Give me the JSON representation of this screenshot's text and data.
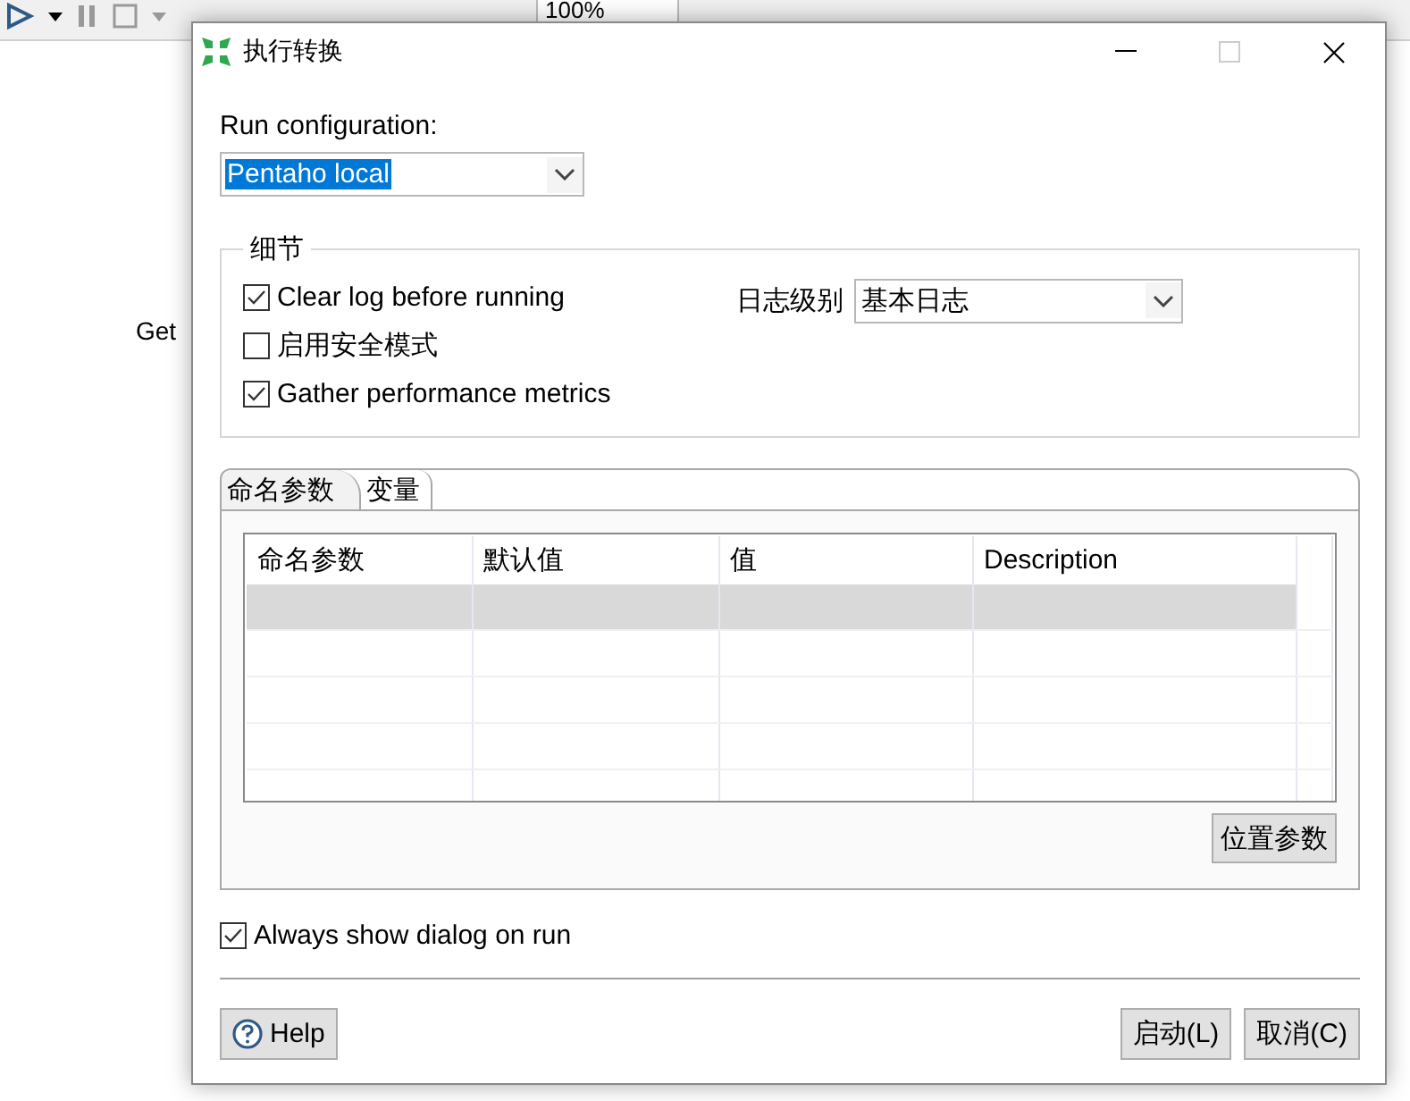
{
  "background": {
    "zoom": "100%",
    "canvas_label": "Get"
  },
  "dialog": {
    "title": "执行转换",
    "run_configuration": {
      "label": "Run configuration:",
      "value": "Pentaho local"
    },
    "details": {
      "title": "细节",
      "options": [
        {
          "label": "Clear log before running",
          "checked": true
        },
        {
          "label": "启用安全模式",
          "checked": false
        },
        {
          "label": "Gather performance metrics",
          "checked": true
        }
      ],
      "log_level": {
        "label": "日志级别",
        "value": "基本日志"
      }
    },
    "tabs": [
      {
        "label": "命名参数",
        "selected": true
      },
      {
        "label": "变量",
        "selected": false
      }
    ],
    "table": {
      "columns": [
        "命名参数",
        "默认值",
        "值",
        "Description"
      ],
      "rows": [
        {
          "selected": true
        },
        {
          "selected": false
        },
        {
          "selected": false
        },
        {
          "selected": false
        },
        {
          "selected": false
        }
      ]
    },
    "position_params_button": "位置参数",
    "always_show": {
      "label": "Always show dialog on run",
      "checked": true
    },
    "buttons": {
      "help": "Help",
      "run": "启动(L)",
      "cancel": "取消(C)"
    }
  }
}
